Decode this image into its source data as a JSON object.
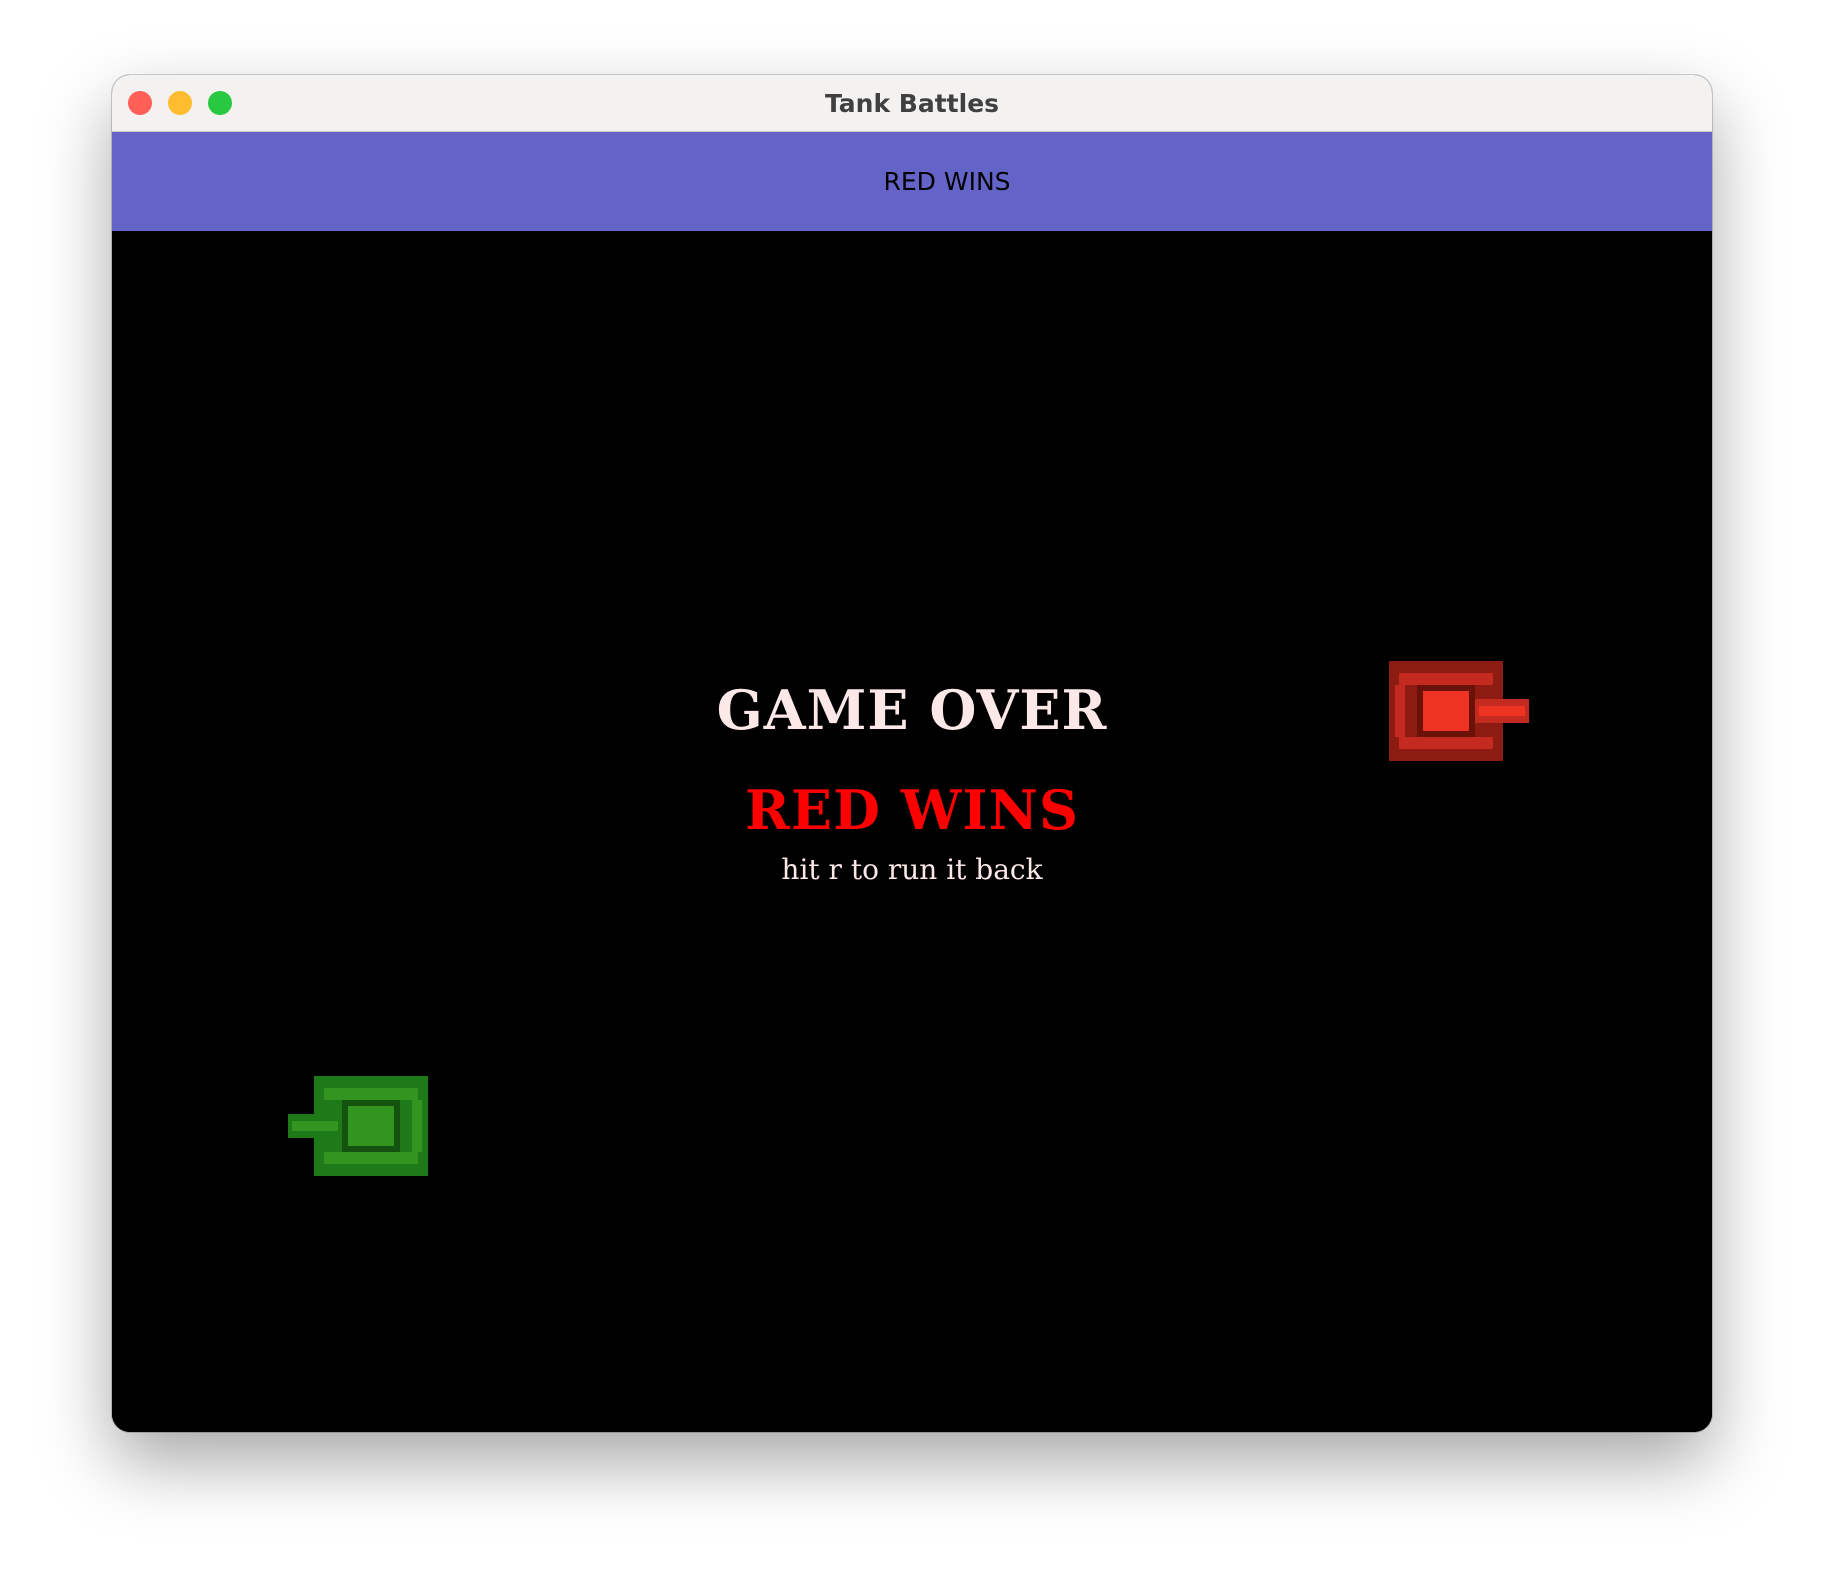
{
  "window": {
    "title": "Tank Battles",
    "traffic_lights": {
      "close_color": "#ff5f57",
      "minimize_color": "#febc2e",
      "maximize_color": "#28c840"
    }
  },
  "status_bar": {
    "text": "RED WINS",
    "background": "#6464c8"
  },
  "game": {
    "background": "#000000",
    "overlay": {
      "title": "GAME OVER",
      "title_color": "#fde8e8",
      "winner": "RED WINS",
      "winner_color": "#ff0000",
      "hint": "hit r to run it back",
      "hint_color": "#fde8e8"
    },
    "tanks": [
      {
        "team": "red",
        "facing": "right",
        "body_color": "#8c1c12",
        "track_color": "#c42a1f",
        "turret_color": "#ee3322"
      },
      {
        "team": "green",
        "facing": "left",
        "body_color": "#1e7a18",
        "track_color": "#14520f",
        "turret_color": "#33951f"
      }
    ]
  }
}
